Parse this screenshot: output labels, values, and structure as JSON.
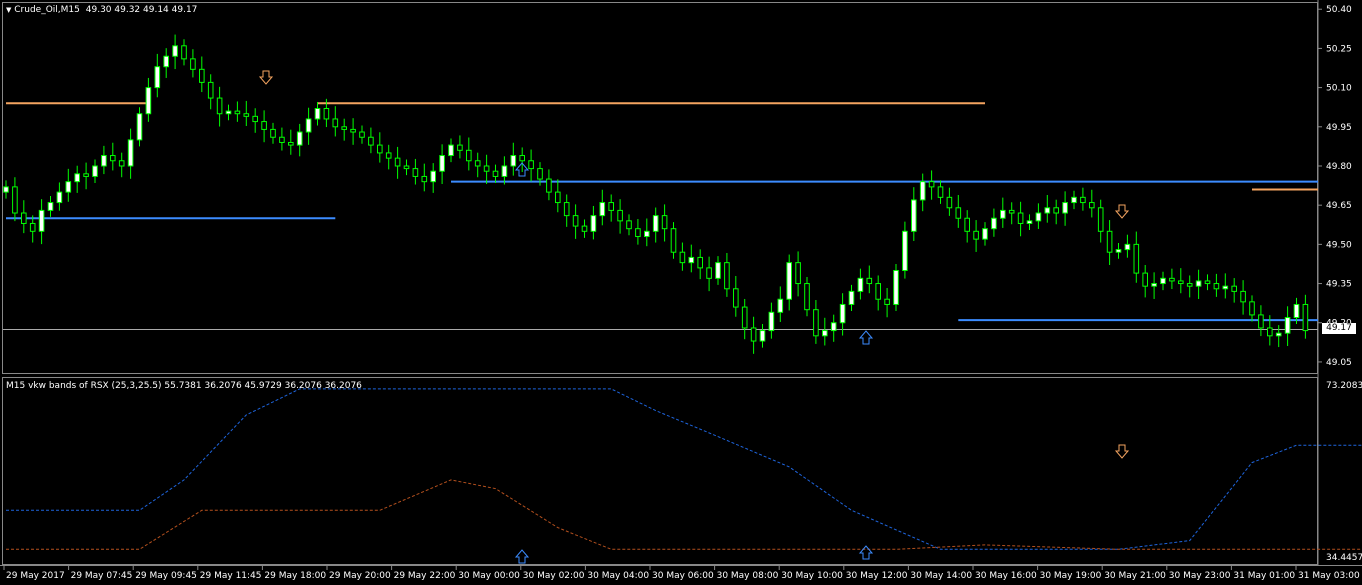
{
  "main_panel": {
    "symbol_label": "Crude_Oil,M15",
    "ohlc": "49.30 49.32 49.14 49.17",
    "collapse_glyph": "▼",
    "current_price": "49.17",
    "price_axis": [
      "50.40",
      "50.25",
      "50.10",
      "49.95",
      "49.80",
      "49.65",
      "49.50",
      "49.35",
      "49.20",
      "49.05"
    ]
  },
  "indicator_panel": {
    "label": "M15 vkw bands of RSX (25,3,25.5) 55.7381 36.2076 45.9729 36.2076 36.2076",
    "axis_top": "73.2083",
    "axis_bottom": "34.4457"
  },
  "time_axis": [
    "29 May 2017",
    "29 May 07:45",
    "29 May 09:45",
    "29 May 11:45",
    "29 May 18:00",
    "29 May 20:00",
    "29 May 22:00",
    "30 May 00:00",
    "30 May 02:00",
    "30 May 04:00",
    "30 May 06:00",
    "30 May 08:00",
    "30 May 10:00",
    "30 May 12:00",
    "30 May 14:00",
    "30 May 16:00",
    "30 May 19:00",
    "30 May 21:00",
    "30 May 23:00",
    "31 May 01:00",
    "31 May 03:00"
  ],
  "colors": {
    "background": "#000000",
    "bull_candle": "#ffffff",
    "candle_wick": "#00ff00",
    "resistance_line": "#f4a460",
    "support_line": "#3c8cff",
    "upper_band": "#1e64dc",
    "lower_band": "#b4501e",
    "sell_arrow": "#f4a460",
    "buy_arrow": "#3c8cff"
  },
  "chart_data": {
    "type": "candlestick",
    "symbol": "Crude_Oil",
    "timeframe": "M15",
    "ylim": [
      49.0,
      50.42
    ],
    "closes": [
      49.72,
      49.62,
      49.58,
      49.55,
      49.63,
      49.66,
      49.7,
      49.74,
      49.77,
      49.76,
      49.8,
      49.84,
      49.82,
      49.8,
      49.9,
      50.0,
      50.1,
      50.18,
      50.22,
      50.26,
      50.21,
      50.17,
      50.12,
      50.06,
      50.0,
      50.01,
      50.0,
      49.99,
      49.97,
      49.94,
      49.91,
      49.89,
      49.88,
      49.93,
      49.98,
      50.02,
      49.98,
      49.95,
      49.94,
      49.93,
      49.91,
      49.88,
      49.85,
      49.83,
      49.8,
      49.79,
      49.76,
      49.74,
      49.78,
      49.84,
      49.88,
      49.86,
      49.82,
      49.8,
      49.78,
      49.76,
      49.8,
      49.84,
      49.82,
      49.79,
      49.75,
      49.7,
      49.66,
      49.61,
      49.57,
      49.55,
      49.61,
      49.66,
      49.63,
      49.59,
      49.56,
      49.53,
      49.55,
      49.61,
      49.56,
      49.47,
      49.43,
      49.45,
      49.41,
      49.37,
      49.43,
      49.33,
      49.26,
      49.18,
      49.13,
      49.17,
      49.24,
      49.29,
      49.43,
      49.35,
      49.25,
      49.15,
      49.17,
      49.2,
      49.27,
      49.32,
      49.37,
      49.35,
      49.29,
      49.27,
      49.4,
      49.55,
      49.67,
      49.74,
      49.72,
      49.68,
      49.64,
      49.6,
      49.55,
      49.52,
      49.56,
      49.6,
      49.63,
      49.62,
      49.58,
      49.59,
      49.62,
      49.64,
      49.62,
      49.66,
      49.68,
      49.66,
      49.64,
      49.55,
      49.47,
      49.48,
      49.5,
      49.39,
      49.34,
      49.35,
      49.37,
      49.36,
      49.35,
      49.34,
      49.36,
      49.35,
      49.33,
      49.34,
      49.32,
      49.28,
      49.23,
      49.18,
      49.15,
      49.16,
      49.22,
      49.27,
      49.17
    ],
    "resistance_levels": [
      {
        "price": 50.04,
        "from": 0,
        "to": 16
      },
      {
        "price": 50.04,
        "from": 35,
        "to": 110
      },
      {
        "price": 49.71,
        "from": 140,
        "to": 200
      }
    ],
    "support_levels": [
      {
        "price": 49.6,
        "from": 0,
        "to": 37
      },
      {
        "price": 49.74,
        "from": 50,
        "to": 148
      },
      {
        "price": 49.21,
        "from": 107,
        "to": 196
      }
    ],
    "indicator": {
      "name": "M15 vkw bands of RSX (25,3,25.5)",
      "values": [
        55.7381,
        36.2076,
        45.9729,
        36.2076,
        36.2076
      ],
      "ylim": [
        34.4457,
        73.2083
      ],
      "upper_band": [
        [
          0,
          45
        ],
        [
          15,
          45
        ],
        [
          20,
          52
        ],
        [
          27,
          67
        ],
        [
          33,
          73
        ],
        [
          40,
          73
        ],
        [
          55,
          73
        ],
        [
          68,
          73
        ],
        [
          73,
          68
        ],
        [
          80,
          62
        ],
        [
          88,
          55
        ],
        [
          95,
          45
        ],
        [
          105,
          36
        ],
        [
          115,
          36
        ],
        [
          125,
          36
        ],
        [
          133,
          38
        ],
        [
          140,
          56
        ],
        [
          145,
          60
        ],
        [
          165,
          60
        ],
        [
          195,
          60
        ]
      ],
      "lower_band": [
        [
          0,
          36
        ],
        [
          15,
          36
        ],
        [
          22,
          45
        ],
        [
          35,
          45
        ],
        [
          42,
          45
        ],
        [
          50,
          52
        ],
        [
          55,
          50
        ],
        [
          62,
          41
        ],
        [
          68,
          36
        ],
        [
          80,
          36
        ],
        [
          100,
          36
        ],
        [
          110,
          37
        ],
        [
          125,
          36
        ],
        [
          155,
          36
        ],
        [
          162,
          45
        ],
        [
          170,
          52
        ],
        [
          177,
          42
        ],
        [
          185,
          37
        ],
        [
          195,
          35
        ]
      ]
    }
  }
}
